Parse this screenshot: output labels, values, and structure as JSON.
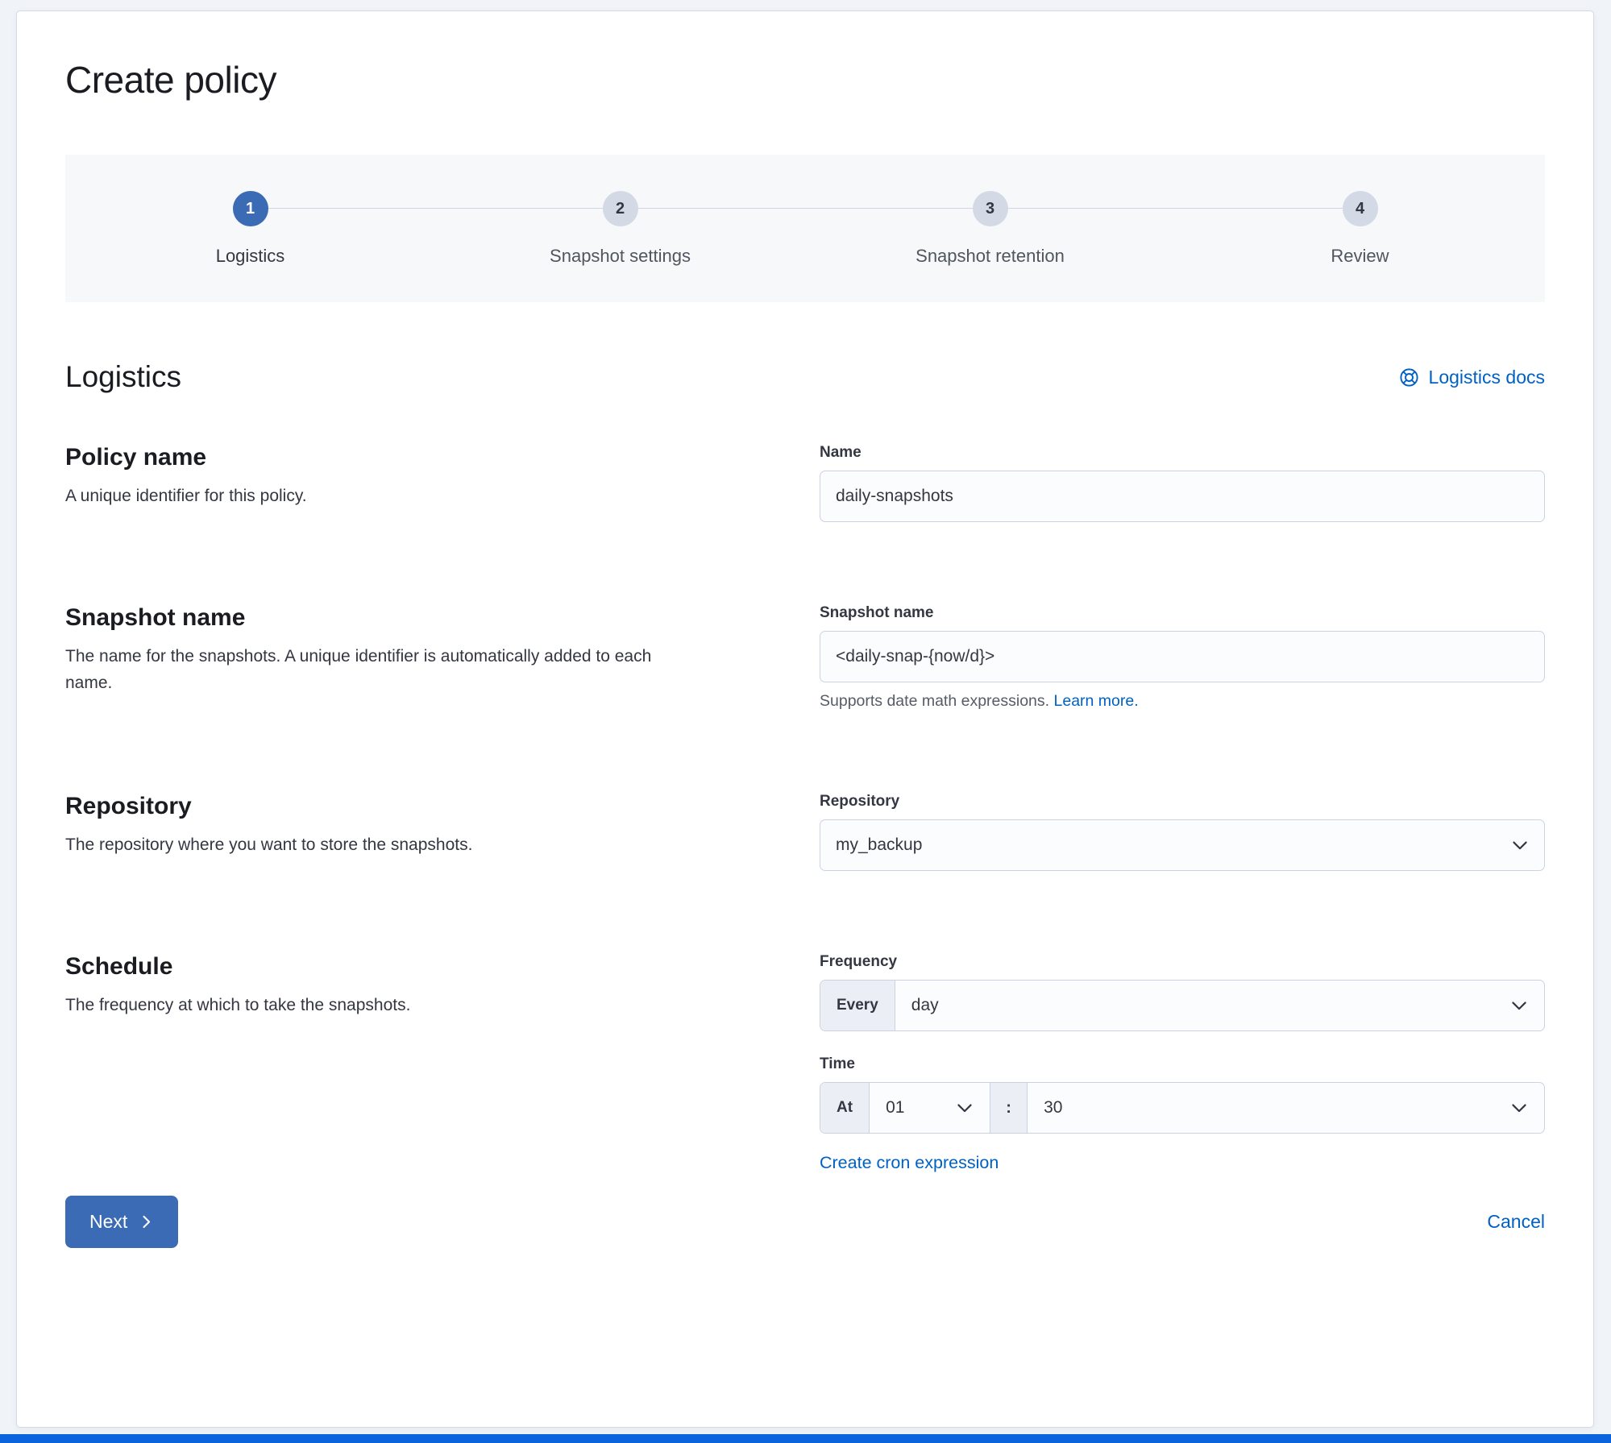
{
  "page": {
    "title": "Create policy"
  },
  "colors": {
    "primary_button": "#3b6bb4",
    "link": "#0061c5",
    "bottom_bar": "#0b64dd"
  },
  "stepper": {
    "steps": [
      {
        "number": "1",
        "label": "Logistics"
      },
      {
        "number": "2",
        "label": "Snapshot settings"
      },
      {
        "number": "3",
        "label": "Snapshot retention"
      },
      {
        "number": "4",
        "label": "Review"
      }
    ]
  },
  "section": {
    "title": "Logistics",
    "docs_link": "Logistics docs"
  },
  "form": {
    "policy_name": {
      "heading": "Policy name",
      "description": "A unique identifier for this policy.",
      "label": "Name",
      "value": "daily-snapshots"
    },
    "snapshot_name": {
      "heading": "Snapshot name",
      "description": "The name for the snapshots. A unique identifier is automatically added to each name.",
      "label": "Snapshot name",
      "value": "<daily-snap-{now/d}>",
      "help_text": "Supports date math expressions. ",
      "help_link": "Learn more."
    },
    "repository": {
      "heading": "Repository",
      "description": "The repository where you want to store the snapshots.",
      "label": "Repository",
      "value": "my_backup"
    },
    "schedule": {
      "heading": "Schedule",
      "description": "The frequency at which to take the snapshots.",
      "frequency_label": "Frequency",
      "frequency_prepend": "Every",
      "frequency_value": "day",
      "time_label": "Time",
      "time_prepend": "At",
      "hour_value": "01",
      "separator": ":",
      "minute_value": "30",
      "cron_link": "Create cron expression"
    }
  },
  "footer": {
    "next_label": "Next",
    "cancel_label": "Cancel"
  }
}
